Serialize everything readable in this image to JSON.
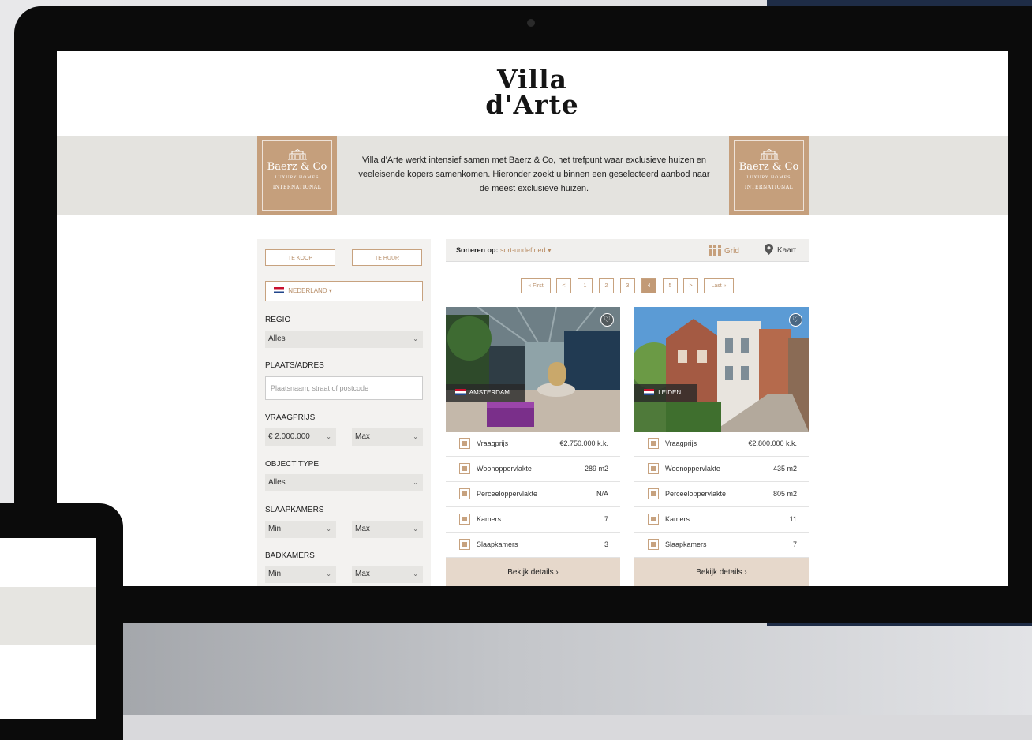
{
  "site": {
    "logo_line1": "Villa",
    "logo_line2": "d'Arte"
  },
  "partner": {
    "name": "Baerz & Co",
    "line1": "LUXURY HOMES",
    "line2": "INTERNATIONAL"
  },
  "intro_text": "Villa d'Arte werkt intensief samen met Baerz & Co, het trefpunt waar exclusieve huizen en veeleisende kopers samenkomen. Hieronder zoekt u binnen een geselecteerd aanbod naar de meest exclusieve huizen.",
  "filters": {
    "buy_label": "TE KOOP",
    "rent_label": "TE HUUR",
    "country": "NEDERLAND",
    "regio_label": "REGIO",
    "regio_value": "Alles",
    "place_label": "PLAATS/ADRES",
    "place_placeholder": "Plaatsnaam, straat of postcode",
    "price_label": "VRAAGPRIJS",
    "price_min": "€ 2.000.000",
    "price_max": "Max",
    "type_label": "OBJECT TYPE",
    "type_value": "Alles",
    "bedrooms_label": "SLAAPKAMERS",
    "bedrooms_min": "Min",
    "bedrooms_max": "Max",
    "bathrooms_label": "BADKAMERS",
    "bathrooms_min": "Min",
    "bathrooms_max": "Max"
  },
  "sortbar": {
    "label": "Sorteren op:",
    "value": "sort-undefined",
    "grid": "Grid",
    "map": "Kaart"
  },
  "pagination": [
    "« First",
    "<",
    "1",
    "2",
    "3",
    "4",
    "5",
    ">",
    "Last »"
  ],
  "current_page": "4",
  "colors": {
    "accent": "#c29a76",
    "banner": "#e4e3df",
    "sidebar": "#f3f2f0"
  },
  "listings": [
    {
      "city": "AMSTERDAM",
      "rows": [
        {
          "icon": "price-icon",
          "label": "Vraagprijs",
          "value": "€2.750.000 k.k."
        },
        {
          "icon": "house-icon",
          "label": "Woonoppervlakte",
          "value": "289 m2"
        },
        {
          "icon": "plot-icon",
          "label": "Perceeloppervlakte",
          "value": "N/A"
        },
        {
          "icon": "rooms-icon",
          "label": "Kamers",
          "value": "7"
        },
        {
          "icon": "bed-icon",
          "label": "Slaapkamers",
          "value": "3"
        }
      ],
      "cta": "Bekijk details ›"
    },
    {
      "city": "LEIDEN",
      "rows": [
        {
          "icon": "price-icon",
          "label": "Vraagprijs",
          "value": "€2.800.000 k.k."
        },
        {
          "icon": "house-icon",
          "label": "Woonoppervlakte",
          "value": "435 m2"
        },
        {
          "icon": "plot-icon",
          "label": "Perceeloppervlakte",
          "value": "805 m2"
        },
        {
          "icon": "rooms-icon",
          "label": "Kamers",
          "value": "11"
        },
        {
          "icon": "bed-icon",
          "label": "Slaapkamers",
          "value": "7"
        }
      ],
      "cta": "Bekijk details ›"
    }
  ]
}
